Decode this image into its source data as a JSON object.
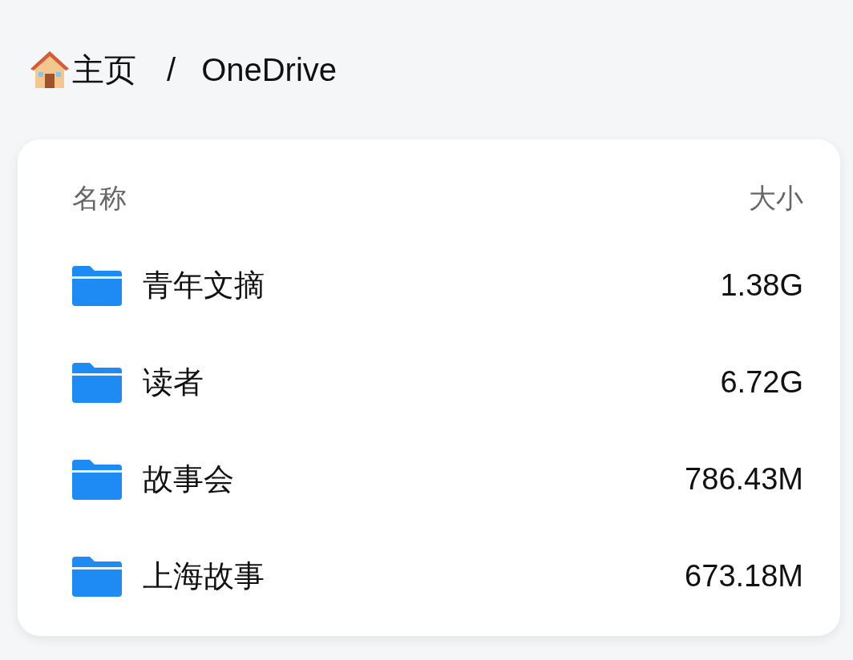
{
  "breadcrumb": [
    {
      "label": "主页",
      "kind": "home"
    },
    {
      "label": "/",
      "kind": "separator"
    },
    {
      "label": "OneDrive",
      "kind": "current"
    }
  ],
  "table": {
    "columns": [
      "名称",
      "大小"
    ],
    "rows": [
      {
        "name": "青年文摘",
        "size": "1.38G",
        "kind": "folder"
      },
      {
        "name": "读者",
        "size": "6.72G",
        "kind": "folder"
      },
      {
        "name": "故事会",
        "size": "786.43M",
        "kind": "folder"
      },
      {
        "name": "上海故事",
        "size": "673.18M",
        "kind": "folder"
      }
    ]
  }
}
